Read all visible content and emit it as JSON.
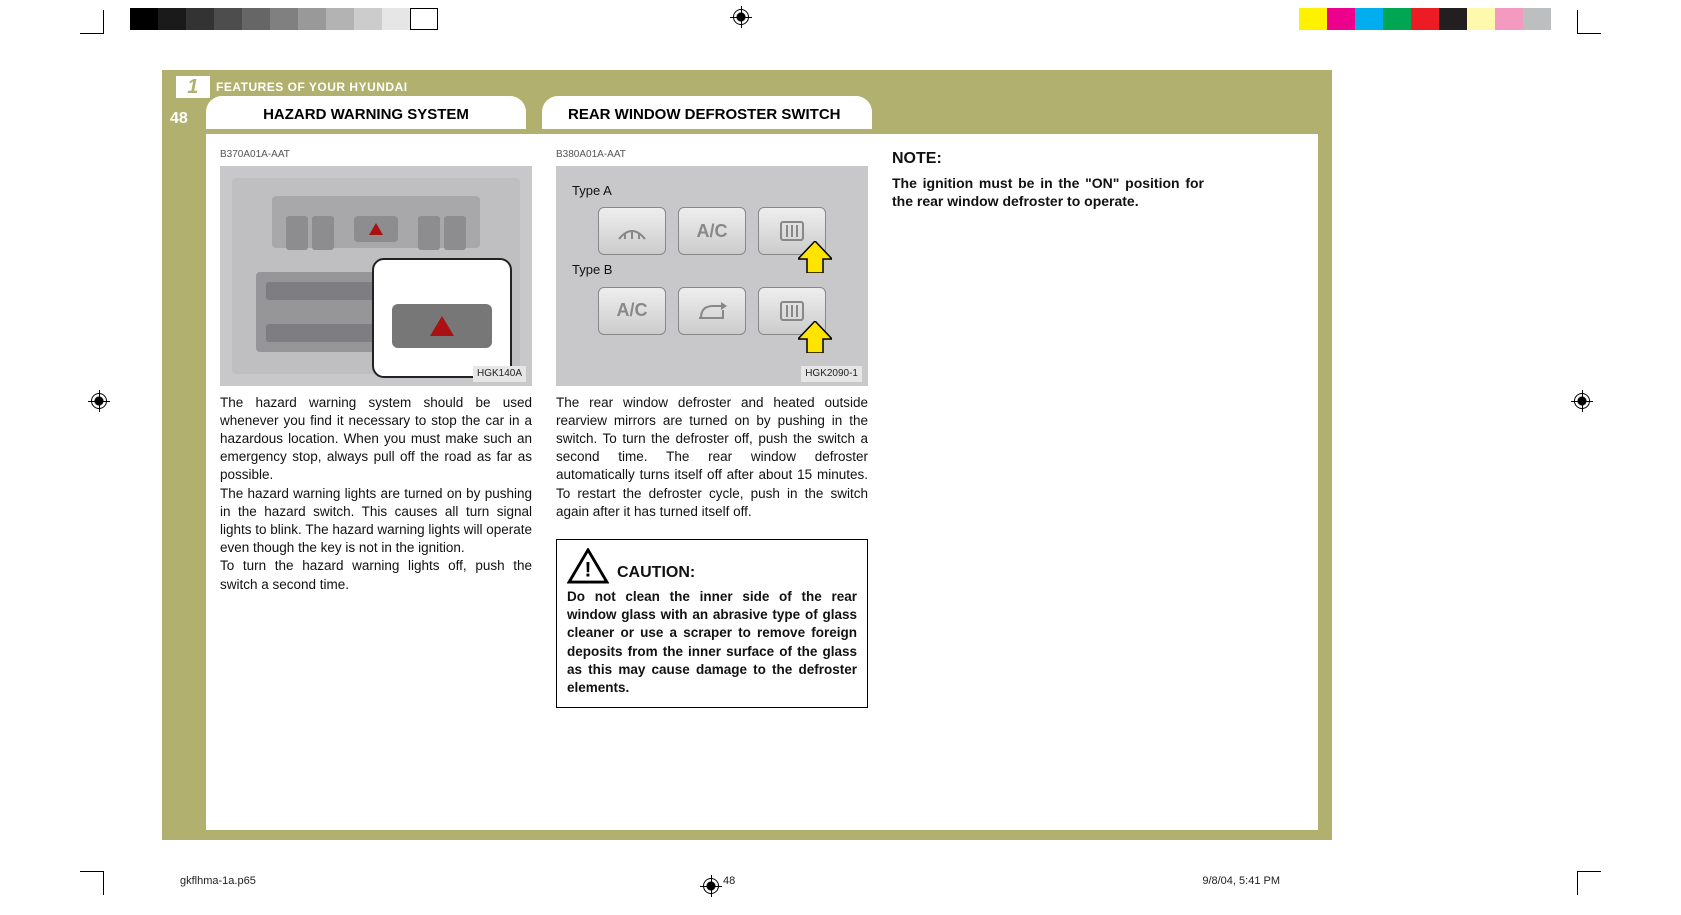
{
  "print": {
    "grayscale": [
      "#000000",
      "#1a1a1a",
      "#333333",
      "#4d4d4d",
      "#666666",
      "#808080",
      "#999999",
      "#b3b3b3",
      "#cccccc",
      "#e6e6e6",
      "#ffffff"
    ],
    "colors": [
      "#fff200",
      "#ec008c",
      "#00aeef",
      "#00a651",
      "#ed1c24",
      "#231f20",
      "#fff9ae",
      "#f49ac1",
      "#bcbec0"
    ]
  },
  "header": {
    "chapter_number": "1",
    "chapter_title": "FEATURES OF YOUR HYUNDAI",
    "page_number": "48"
  },
  "tabs": {
    "tab1": "HAZARD WARNING SYSTEM",
    "tab2": "REAR WINDOW DEFROSTER SWITCH"
  },
  "col1": {
    "ref": "B370A01A-AAT",
    "fig_label": "HGK140A",
    "p1": "The hazard warning system should be used whenever you find it necessary to stop the car in a hazardous location. When you must make such an emergency stop, always pull off the road as far as possible.",
    "p2": "The hazard warning lights are turned on by pushing in the hazard switch. This causes all turn signal lights to blink. The hazard warning lights will operate even though the key is not in the ignition.",
    "p3": "To turn the hazard warning lights off, push the switch a second time."
  },
  "col2": {
    "ref": "B380A01A-AAT",
    "type_a": "Type A",
    "type_b": "Type B",
    "ac_label": "A/C",
    "fig_label": "HGK2090-1",
    "p1": "The rear window defroster and heated outside rearview mirrors are turned on by pushing in the switch. To turn the defroster off, push the switch a second time. The rear window defroster automatically turns itself off after about 15 minutes. To restart the defroster cycle, push in the switch again after it has turned itself off.",
    "caution_title": "CAUTION:",
    "caution_body": "Do not clean the inner side of the rear window glass with an abrasive type of glass cleaner or use a scraper to remove foreign deposits from the inner surface of the glass as this may cause damage to the defroster elements."
  },
  "col3": {
    "note_title": "NOTE:",
    "note_body": "The ignition must be in the \"ON\" position for the rear window defroster to operate."
  },
  "footer": {
    "file": "gkflhma-1a.p65",
    "page": "48",
    "date": "9/8/04, 5:41 PM"
  }
}
